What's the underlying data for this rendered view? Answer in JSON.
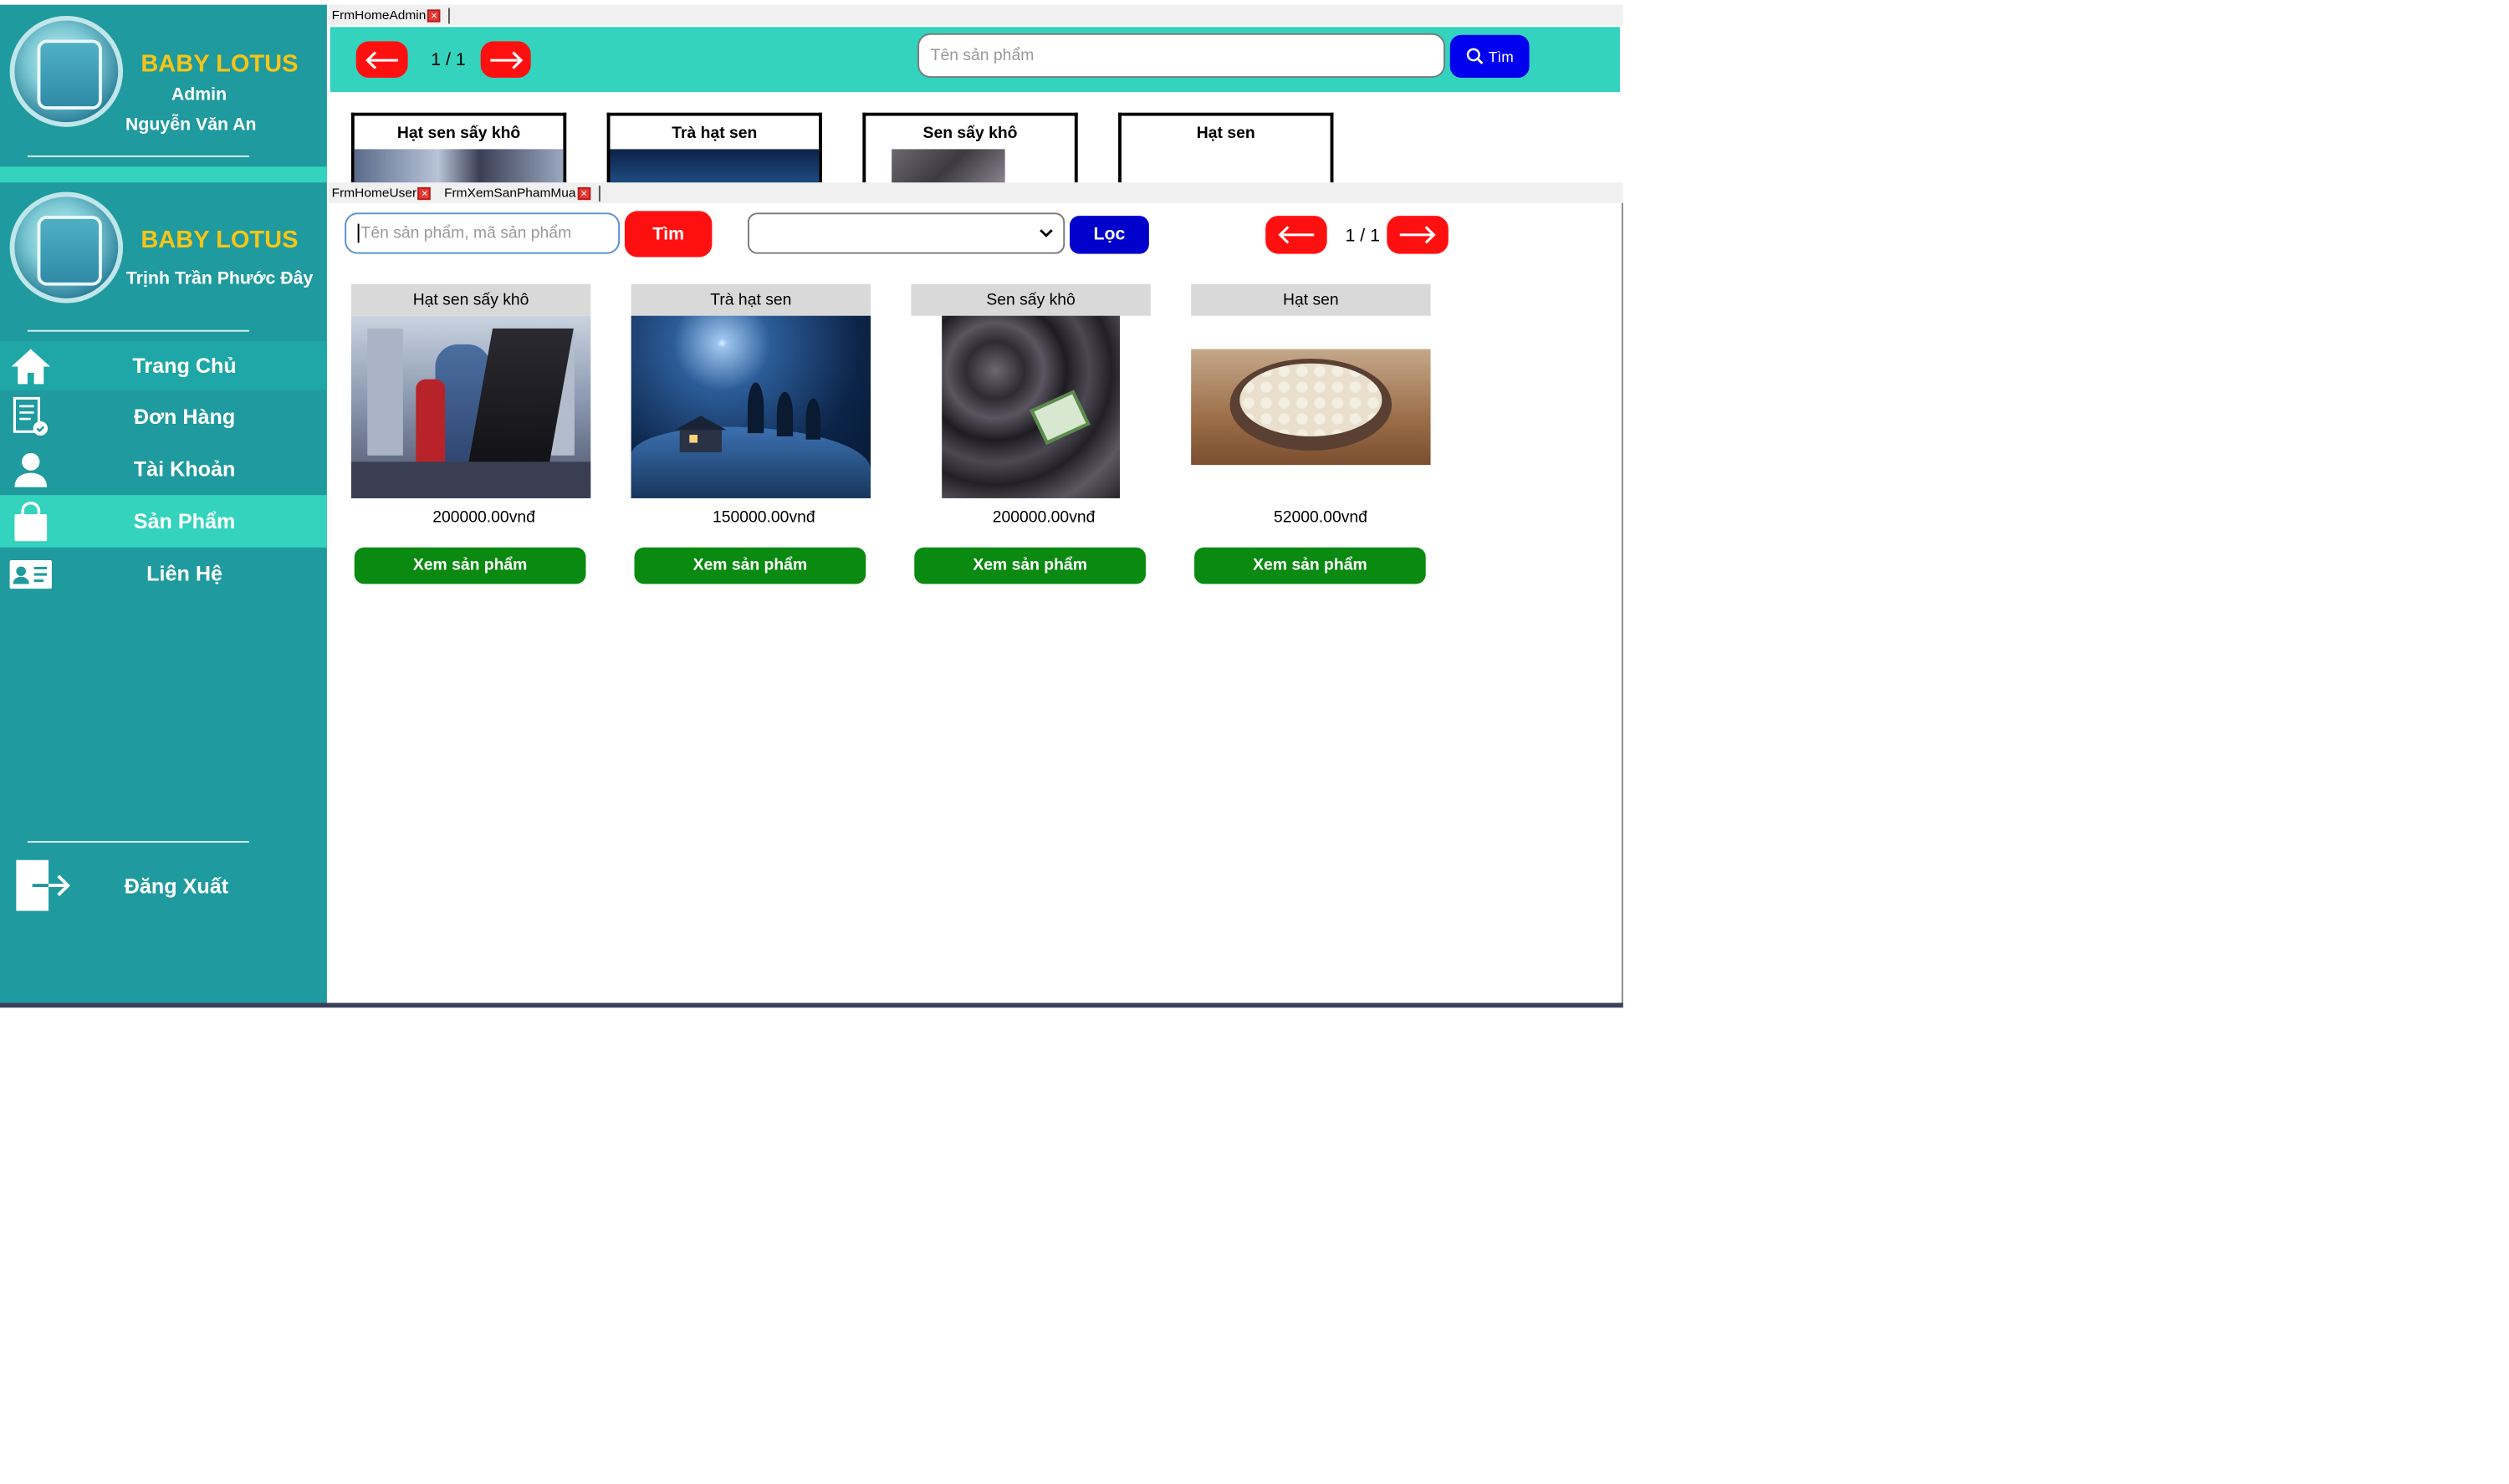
{
  "admin_form": {
    "tab": "FrmHomeAdmin",
    "brand": "BABY LOTUS",
    "role": "Admin",
    "user_name": "Nguyễn Văn An",
    "page_indicator": "1 / 1",
    "search_placeholder": "Tên sản phẩm",
    "search_button": "Tìm",
    "products": [
      "Hạt sen sấy khô",
      "Trà hạt sen",
      "Sen sấy khô",
      "Hạt sen"
    ]
  },
  "user_form": {
    "tabs": [
      "FrmHomeUser",
      "FrmXemSanPhamMua"
    ],
    "brand": "BABY LOTUS",
    "user_name": "Trịnh Trần Phước Đây",
    "nav": [
      {
        "label": "Trang Chủ",
        "icon": "home-icon",
        "active": false
      },
      {
        "label": "Đơn Hàng",
        "icon": "order-list-icon",
        "active": false
      },
      {
        "label": "Tài Khoản",
        "icon": "user-icon",
        "active": false
      },
      {
        "label": "Sản Phẩm",
        "icon": "shopping-bag-icon",
        "active": true
      },
      {
        "label": "Liên Hệ",
        "icon": "contact-card-icon",
        "active": false
      }
    ],
    "logout_label": "Đăng Xuất",
    "search_placeholder": "Tên sản phẩm, mã sản phẩm",
    "search_button": "Tìm",
    "filter_selected": "",
    "filter_button": "Lọc",
    "page_indicator": "1 / 1",
    "view_button": "Xem sản phẩm",
    "products": [
      {
        "name": "Hạt sen sấy khô",
        "price": "200000.00vnđ",
        "image": "fantasy-knights-image"
      },
      {
        "name": "Trà hạt sen",
        "price": "150000.00vnđ",
        "image": "night-house-image"
      },
      {
        "name": "Sen sấy khô",
        "price": "200000.00vnđ",
        "image": "dried-lotus-bag-image"
      },
      {
        "name": "Hạt sen",
        "price": "52000.00vnđ",
        "image": "lotus-seeds-bowl-image"
      }
    ]
  },
  "colors": {
    "sidebar": "#1f9a9e",
    "active_nav": "#33d3bd",
    "header_bar": "#33d3bd",
    "brand_text": "#f5c518",
    "red_button": "#ff1010",
    "blue_button": "#0000cc",
    "green_button": "#0a8a10"
  }
}
